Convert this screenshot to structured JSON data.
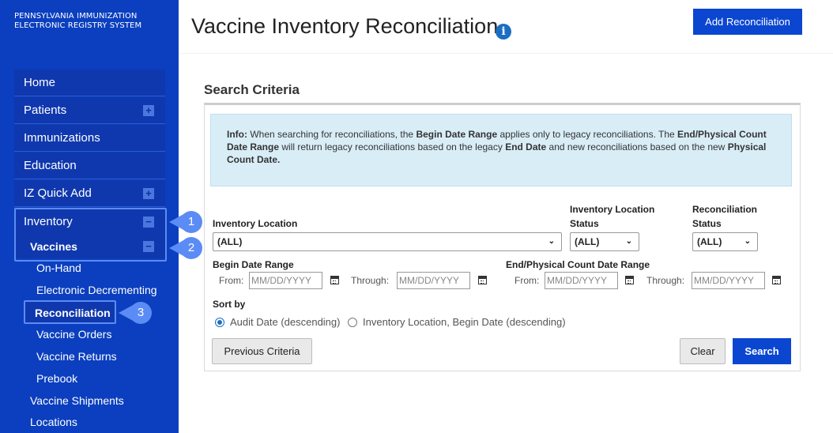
{
  "sidebar": {
    "brand_line1": "PENNSYLVANIA IMMUNIZATION",
    "brand_line2": "ELECTRONIC REGISTRY SYSTEM",
    "items": {
      "home": "Home",
      "patients": "Patients",
      "immunizations": "Immunizations",
      "education": "Education",
      "iz_quick_add": "IZ Quick Add",
      "inventory": "Inventory",
      "vaccines": "Vaccines",
      "on_hand": "On-Hand",
      "electronic_decrementing": "Electronic Decrementing",
      "reconciliation": "Reconciliation",
      "vaccine_orders": "Vaccine Orders",
      "vaccine_returns": "Vaccine Returns",
      "prebook": "Prebook",
      "vaccine_shipments": "Vaccine Shipments",
      "locations": "Locations"
    },
    "expand_icon": "+",
    "collapse_icon": "−",
    "callouts": [
      "1",
      "2",
      "3"
    ]
  },
  "header": {
    "title": "Vaccine Inventory Reconciliation",
    "info_icon": "i",
    "add_button": "Add Reconciliation"
  },
  "search": {
    "section_title": "Search Criteria",
    "info": {
      "prefix": "Info:",
      "t1": " When searching for reconciliations, the ",
      "b1": "Begin Date Range",
      "t2": " applies only to legacy reconciliations. The ",
      "b2": "End/Physical Count Date Range",
      "t3": " will return legacy reconciliations based on the legacy ",
      "b3": "End Date",
      "t4": " and new reconciliations based on the new ",
      "b4": "Physical Count Date."
    },
    "inventory_location_label": "Inventory Location",
    "inventory_location_value": "(ALL)",
    "inv_loc_status_label_1": "Inventory Location",
    "inv_loc_status_label_2": "Status",
    "inv_loc_status_value": "(ALL)",
    "recon_status_label_1": "Reconciliation",
    "recon_status_label_2": "Status",
    "recon_status_value": "(ALL)",
    "begin_date_range_label": "Begin Date Range",
    "end_date_range_label": "End/Physical Count Date Range",
    "from_label": "From:",
    "through_label": "Through:",
    "date_placeholder": "MM/DD/YYYY",
    "sort_by_label": "Sort by",
    "sort_options": [
      "Audit Date (descending)",
      "Inventory Location, Begin Date (descending)"
    ],
    "sort_selected": 0,
    "previous_criteria_button": "Previous Criteria",
    "clear_button": "Clear",
    "search_button": "Search",
    "chevron_glyph": "⌄"
  },
  "colors": {
    "sidebar_bg": "#0b3fbf",
    "primary_button": "#0b46d1",
    "callout": "#5b8cf5",
    "info_bg": "#d9edf7"
  }
}
